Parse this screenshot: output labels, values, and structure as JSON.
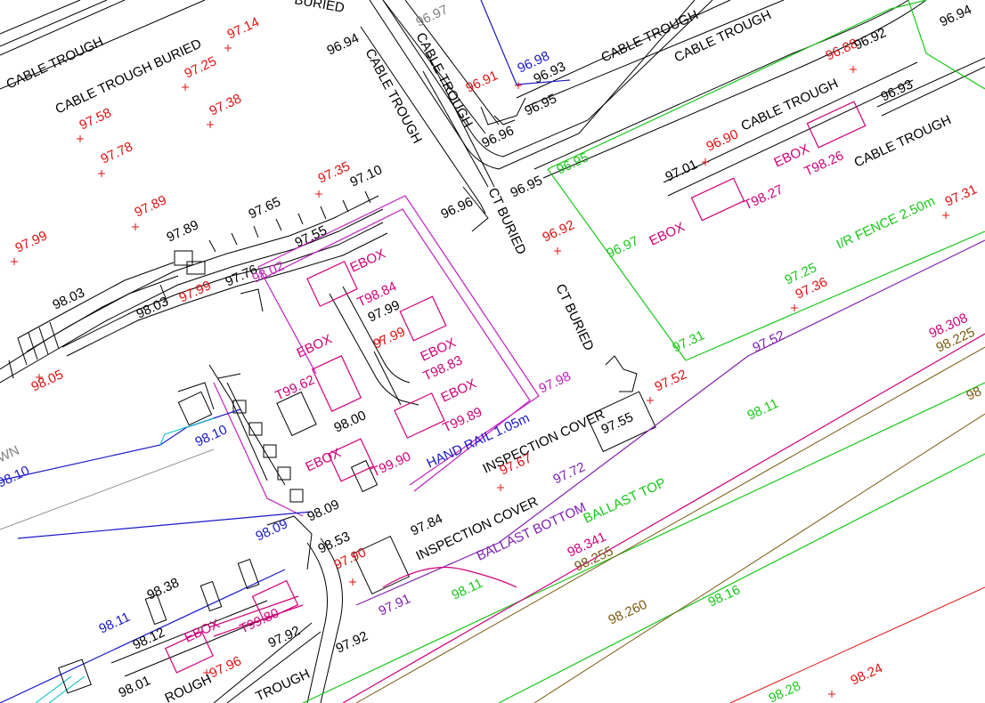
{
  "colors": {
    "black": "#000000",
    "red": "#e01010",
    "magenta": "#d0007a",
    "green": "#18c818",
    "blue": "#1818c8",
    "purple": "#8020b0",
    "olive": "#7a5a10",
    "grey": "#808080",
    "cyan": "#00c0c0",
    "violet": "#c020c0"
  },
  "labels": {
    "cable_trough_buried_top": "CABLE TROUGH BURIED",
    "cable_trough_topleft": "CABLE TROUGH",
    "buried_topright": "BURIED",
    "cable_trough_vert": "CABLE TROUGH",
    "cable_trough_vert2": "CABLE TROUGH",
    "cable_trough_top1": "CABLE TROUGH",
    "cable_trough_top2": "CABLE TROUGH",
    "cable_trough_right": "CABLE TROUGH",
    "cable_trough_far_right": "CABLE TROUGH",
    "ct_buried_1": "CT BURIED",
    "ct_buried_2": "CT BURIED",
    "ir_fence": "I/R FENCE 2.50m",
    "hand_rail": "HAND RAIL 1.05m",
    "inspection_cover_1": "INSPECTION COVER",
    "inspection_cover_2": "INSPECTION COVER",
    "ballast_top": "BALLAST TOP",
    "ballast_bottom": "BALLAST BOTTOM",
    "trough_bottom_left": "ROUGH",
    "trough_bottom_mid": "TROUGH",
    "wn_fragment": "WN"
  },
  "ebox": {
    "e1": "EBOX",
    "e1_t": "T98.84",
    "e2": "EBOX",
    "e2_t": "T98.83",
    "e3": "EBOX",
    "e3_t": "T99.62",
    "e4": "EBOX",
    "e4_t": "T99.89",
    "e5": "EBOX",
    "e5_t": "T99.90",
    "e6": "EBOX",
    "e6_t": "T98.26",
    "e7": "EBOX",
    "e7_t": "T98.27",
    "e8": "EBOX",
    "e8_t": "T99.80"
  },
  "levels": {
    "r97_14": "97.14",
    "r97_25": "97.25",
    "r97_58": "97.58",
    "r97_38": "97.38",
    "r97_78": "97.78",
    "r97_89": "97.89",
    "r97_99a": "97.99",
    "r97_35": "97.35",
    "r97_99b": "97.99",
    "r98_05": "98.05",
    "r96_91": "96.91",
    "r96_88": "96.88",
    "r96_90": "96.90",
    "r96_92": "96.92",
    "r97_52": "97.52",
    "r97_67": "97.67",
    "r97_90": "97.90",
    "r97_96": "97.96",
    "r97_99c": "97.99",
    "r98_24": "98.24",
    "r97_31": "97.31",
    "r97_36": "97.36",
    "k96_94a": "96.94",
    "k96_92": "96.92",
    "k96_93a": "96.93",
    "k96_93b": "96.93",
    "k96_95a": "96.95",
    "k96_96a": "96.96",
    "k96_96b": "96.96",
    "k96_95b": "96.95",
    "k97_01": "97.01",
    "k97_10": "97.10",
    "k97_65": "97.65",
    "k97_89": "97.89",
    "k97_55a": "97.55",
    "k97_76": "97.76",
    "k98_03a": "98.03",
    "k98_03b": "98.03",
    "k97_99": "97.99",
    "k98_00": "98.00",
    "k97_55b": "97.55",
    "k98_09": "98.09",
    "k98_53": "98.53",
    "k97_84": "97.84",
    "k98_38": "98.38",
    "k98_12": "98.12",
    "k97_92a": "97.92",
    "k97_92b": "97.92",
    "k98_01": "98.01",
    "k96_94b": "96.94",
    "g96_97": "96.97",
    "b96_98": "96.98",
    "b98_10a": "98.10",
    "b98_10b": "98.10",
    "b98_09": "98.09",
    "b98_11": "98.11",
    "m98_02": "98.02",
    "m97_98": "97.98",
    "gr96_95": "96.95",
    "gr96_97": "96.97",
    "gr97_25": "97.25",
    "gr97_31": "97.31",
    "gr98_11a": "98.11",
    "gr98_11b": "98.11",
    "gr98_16": "98.16",
    "gr98_28": "98.28",
    "p97_52": "97.52",
    "p97_72": "97.72",
    "p97_91": "97.91",
    "mg98_308": "98.308",
    "mg98_341": "98.341",
    "o98_225": "98.225",
    "o98_255": "98.255",
    "o98_260": "98.260",
    "o98_frag": "98"
  }
}
